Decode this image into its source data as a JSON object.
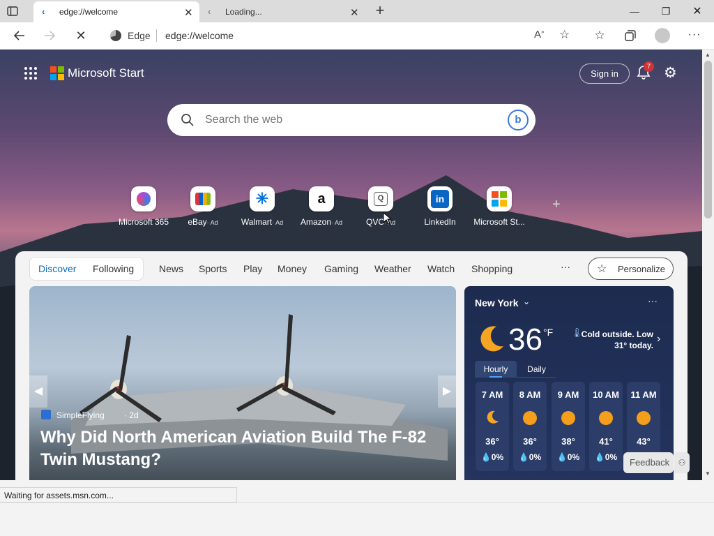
{
  "tabs": [
    {
      "title": "edge://welcome",
      "active": true
    },
    {
      "title": "Loading...",
      "active": false
    }
  ],
  "address": {
    "site_label": "Edge",
    "url": "edge://welcome"
  },
  "header": {
    "brand": "Microsoft Start",
    "sign_in": "Sign in",
    "notification_count": "7"
  },
  "search": {
    "placeholder": "Search the web"
  },
  "quicklinks": [
    {
      "label": "Microsoft 365",
      "ad": ""
    },
    {
      "label": "eBay",
      "ad": "· Ad"
    },
    {
      "label": "Walmart",
      "ad": "· Ad"
    },
    {
      "label": "Amazon",
      "ad": "· Ad"
    },
    {
      "label": "QVC",
      "ad": "· Ad"
    },
    {
      "label": "LinkedIn",
      "ad": ""
    },
    {
      "label": "Microsoft St...",
      "ad": ""
    }
  ],
  "feed_nav": {
    "discover": "Discover",
    "following": "Following",
    "items": [
      "News",
      "Sports",
      "Play",
      "Money",
      "Gaming",
      "Weather",
      "Watch",
      "Shopping"
    ],
    "more": "···",
    "personalize": "Personalize"
  },
  "hero": {
    "source": "SimpleFlying",
    "age": "· 2d",
    "headline": "Why Did North American Aviation Build The F-82 Twin Mustang?"
  },
  "weather": {
    "city": "New York",
    "temp": "36",
    "unit": "°F",
    "summary": "Cold outside. Low 31° today.",
    "tab_hourly": "Hourly",
    "tab_daily": "Daily",
    "hours": [
      {
        "time": "7 AM",
        "temp": "36°",
        "precip": "0%",
        "icon": "moon-icon"
      },
      {
        "time": "8 AM",
        "temp": "36°",
        "precip": "0%",
        "icon": "sun-icon"
      },
      {
        "time": "9 AM",
        "temp": "38°",
        "precip": "0%",
        "icon": "sun-icon"
      },
      {
        "time": "10 AM",
        "temp": "41°",
        "precip": "0%",
        "icon": "sun-icon"
      },
      {
        "time": "11 AM",
        "temp": "43°",
        "precip": "0%",
        "icon": "sun-icon"
      }
    ]
  },
  "feedback": "Feedback",
  "status": "Waiting for assets.msn.com...",
  "colors": {
    "accent": "#0f6cbd",
    "sun": "#f59e1b"
  }
}
